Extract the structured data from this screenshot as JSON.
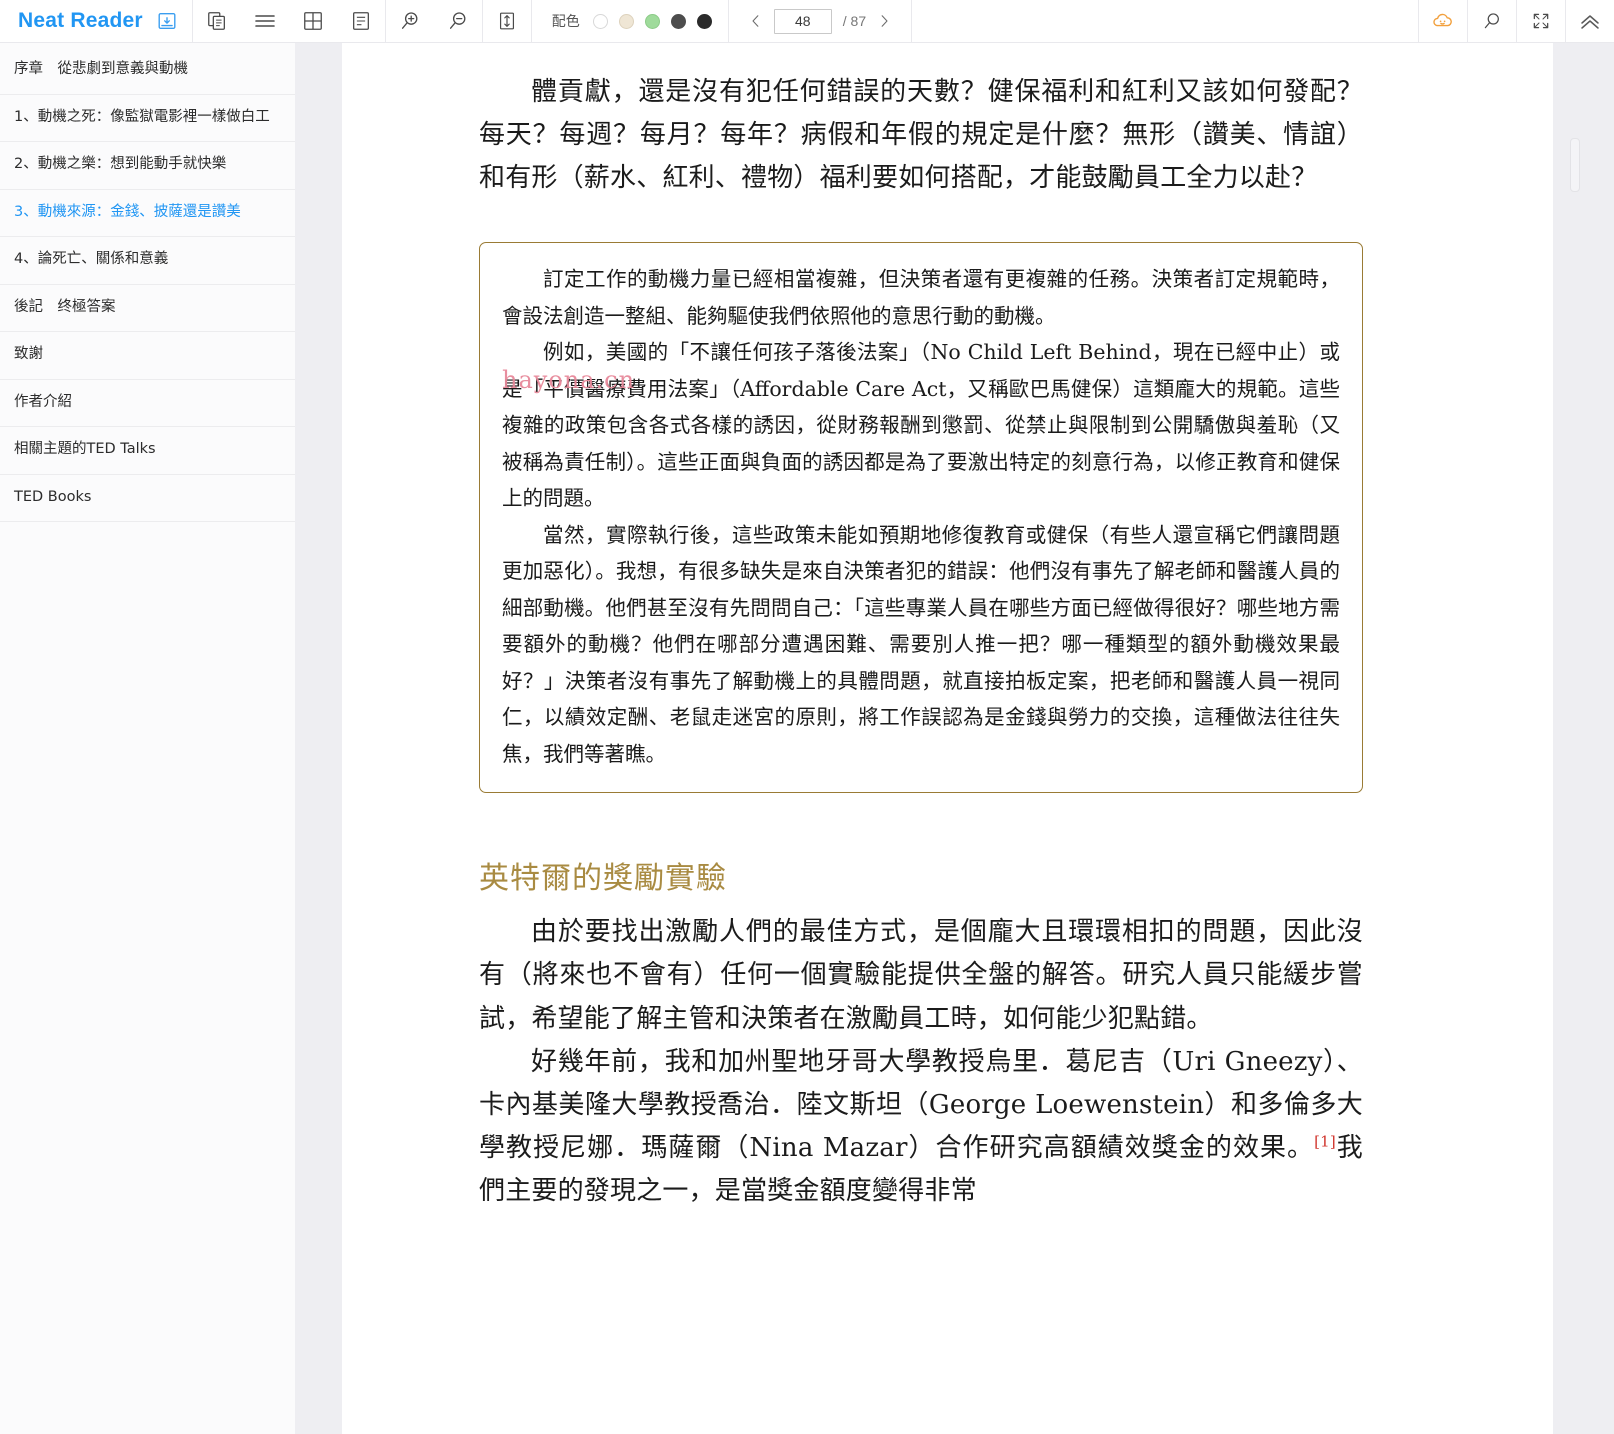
{
  "app": {
    "brand": "Neat Reader"
  },
  "toolbar": {
    "icons": [
      {
        "name": "save-to-library-icon",
        "label": "save-to-library"
      },
      {
        "name": "copy-icon",
        "label": "copy"
      },
      {
        "name": "menu-icon",
        "label": "menu"
      },
      {
        "name": "grid-layout-icon",
        "label": "grid-layout"
      },
      {
        "name": "page-layout-icon",
        "label": "page-layout"
      },
      {
        "name": "zoom-in-icon",
        "label": "zoom-in"
      },
      {
        "name": "zoom-out-icon",
        "label": "zoom-out"
      },
      {
        "name": "line-height-icon",
        "label": "line-height"
      }
    ],
    "color_scheme": {
      "label": "配色",
      "swatches": [
        {
          "name": "swatch-white",
          "color": "#ffffff",
          "border": "#d8d8d8",
          "selected": false
        },
        {
          "name": "swatch-sepia",
          "color": "#efe6d5",
          "border": "#ddd2bd",
          "selected": false
        },
        {
          "name": "swatch-green",
          "color": "#9fdb9b",
          "border": "#8ccb88",
          "selected": false
        },
        {
          "name": "swatch-dark-gray",
          "color": "#4d4d4d",
          "border": "#4d4d4d",
          "selected": false
        },
        {
          "name": "swatch-black",
          "color": "#2b2b2b",
          "border": "#2b2b2b",
          "selected": true
        }
      ]
    },
    "paging": {
      "prev_label": "‹",
      "next_label": "›",
      "current_page": "48",
      "page_placeholder": "48",
      "total_label": "/ 87"
    },
    "right_icons": [
      {
        "name": "cloud-sync-icon",
        "label": "cloud-sync",
        "color": "#f2a03d"
      },
      {
        "name": "search-icon",
        "label": "search"
      },
      {
        "name": "fullscreen-icon",
        "label": "fullscreen"
      },
      {
        "name": "collapse-toolbar-icon",
        "label": "collapse-toolbar"
      }
    ]
  },
  "sidebar": {
    "items": [
      {
        "label": "序章　從悲劇到意義與動機",
        "active": false
      },
      {
        "label": "1、動機之死：像監獄電影裡一樣做白工",
        "active": false
      },
      {
        "label": "2、動機之樂：想到能動手就快樂",
        "active": false
      },
      {
        "label": "3、動機來源：金錢、披薩還是讚美",
        "active": true
      },
      {
        "label": "4、論死亡、關係和意義",
        "active": false
      },
      {
        "label": "後記　终極答案",
        "active": false
      },
      {
        "label": "致謝",
        "active": false
      },
      {
        "label": "作者介紹",
        "active": false
      },
      {
        "label": "相關主題的TED Talks",
        "active": false
      },
      {
        "label": "TED Books",
        "active": false
      }
    ]
  },
  "content": {
    "paragraph_top": "體貢獻，還是沒有犯任何錯誤的天數？健保福利和紅利又該如何發配？每天？每週？每月？每年？病假和年假的規定是什麼？無形（讚美、情誼）和有形（薪水、紅利、禮物）福利要如何搭配，才能鼓勵員工全力以赴？",
    "quote_box": {
      "p1": "訂定工作的動機力量已經相當複雜，但決策者還有更複雜的任務。決策者訂定規範時，會設法創造一整組、能夠驅使我們依照他的意思行動的動機。",
      "p2": "例如，美國的「不讓任何孩子落後法案」（No Child Left Behind，現在已經中止）或是「平價醫療費用法案」（Affordable Care Act，又稱歐巴馬健保）這類龐大的規範。這些複雜的政策包含各式各樣的誘因，從財務報酬到懲罰、從禁止與限制到公開驕傲與羞恥（又被稱為責任制）。這些正面與負面的誘因都是為了要激出特定的刻意行為，以修正教育和健保上的問題。",
      "p3": "當然，實際執行後，這些政策未能如預期地修復教育或健保（有些人還宣稱它們讓問題更加惡化）。我想，有很多缺失是來自決策者犯的錯誤：他們沒有事先了解老師和醫護人員的細部動機。他們甚至沒有先問問自己：「這些專業人員在哪些方面已經做得很好？哪些地方需要額外的動機？他們在哪部分遭遇困難、需要別人推一把？哪一種類型的額外動機效果最好？」決策者沒有事先了解動機上的具體問題，就直接拍板定案，把老師和醫護人員一視同仁，以績效定酬、老鼠走迷宮的原則，將工作誤認為是金錢與勞力的交換，這種做法往往失焦，我們等著瞧。"
    },
    "watermark": "hayona.cn",
    "section_heading": "英特爾的獎勵實驗",
    "paragraph_after_heading": "由於要找出激勵人們的最佳方式，是個龐大且環環相扣的問題，因此沒有（將來也不會有）任何一個實驗能提供全盤的解答。研究人員只能緩步嘗試，希望能了解主管和決策者在激勵員工時，如何能少犯點錯。",
    "paragraph_last_a": "好幾年前，我和加州聖地牙哥大學教授烏里．葛尼吉（Uri Gneezy）、卡內基美隆大學教授喬治．陸文斯坦（George Loewenstein）和多倫多大學教授尼娜．瑪薩爾（Nina Mazar）合作研究高額績效獎金的效果。",
    "footnote_marker": "[1]",
    "paragraph_last_b": "我們主要的發現之一，是當獎金額度變得非常"
  }
}
